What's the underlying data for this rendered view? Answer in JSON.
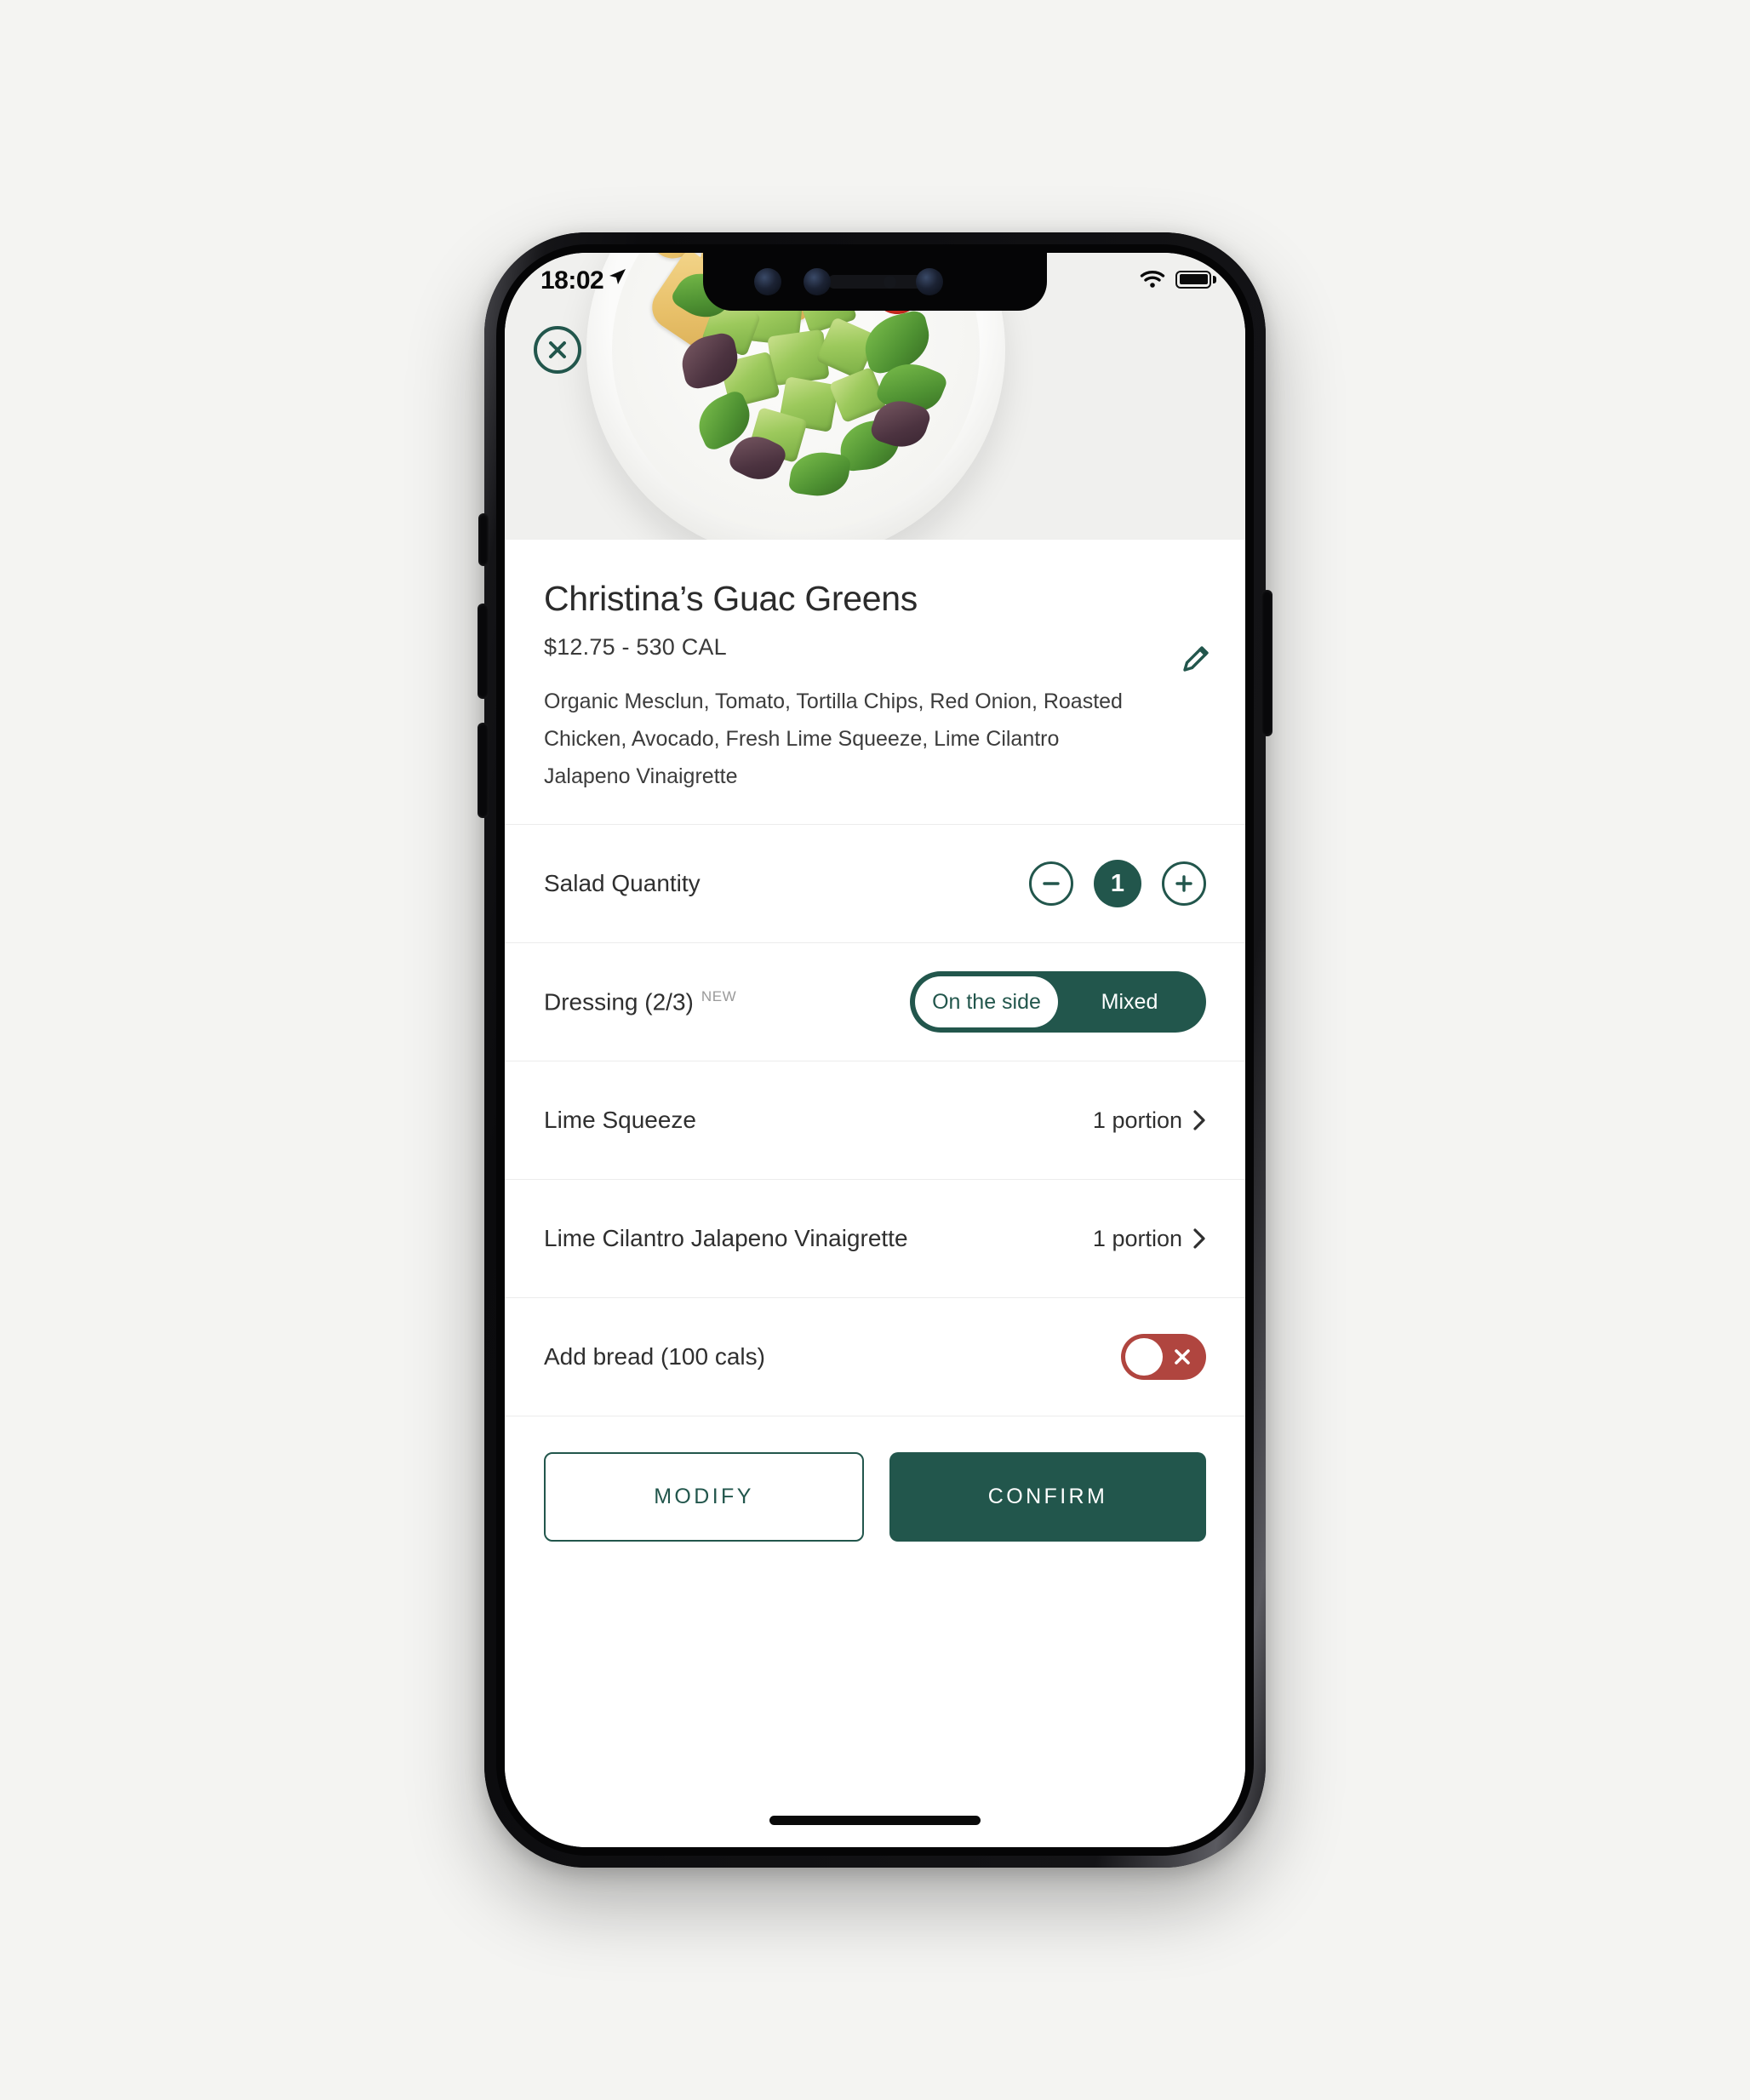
{
  "status_bar": {
    "time": "18:02",
    "location_icon": "location-arrow-icon",
    "wifi_icon": "wifi-icon",
    "battery_icon": "battery-full-icon"
  },
  "hero": {
    "image_alt": "salad-bowl-photo",
    "close_icon": "close-circle-icon"
  },
  "item": {
    "title": "Christina’s Guac Greens",
    "price_calories": "$12.75 - 530 CAL",
    "description": "Organic Mesclun, Tomato, Tortilla Chips, Red Onion, Roasted Chicken, Avocado, Fresh Lime Squeeze, Lime Cilantro Jalapeno Vinaigrette",
    "edit_icon": "pencil-icon"
  },
  "quantity_row": {
    "label": "Salad Quantity",
    "value": "1",
    "decrement_icon": "minus-circle-icon",
    "increment_icon": "plus-circle-icon"
  },
  "dressing_row": {
    "label": "Dressing (2/3)",
    "badge": "NEW",
    "options": [
      "On the side",
      "Mixed"
    ],
    "selected": "On the side"
  },
  "portions": [
    {
      "label": "Lime Squeeze",
      "value": "1 portion",
      "chevron_icon": "chevron-right-icon"
    },
    {
      "label": "Lime Cilantro Jalapeno Vinaigrette",
      "value": "1 portion",
      "chevron_icon": "chevron-right-icon"
    }
  ],
  "bread_row": {
    "label": "Add bread (100 cals)",
    "toggle_state": "off",
    "toggle_icon": "close-x-icon"
  },
  "actions": {
    "modify_label": "MODIFY",
    "confirm_label": "CONFIRM"
  },
  "colors": {
    "brand_green": "#22564C",
    "toggle_red": "#B0453F",
    "text_primary": "#2F2F2F",
    "divider": "#ECECEC",
    "hero_background": "#F0F0EE"
  }
}
